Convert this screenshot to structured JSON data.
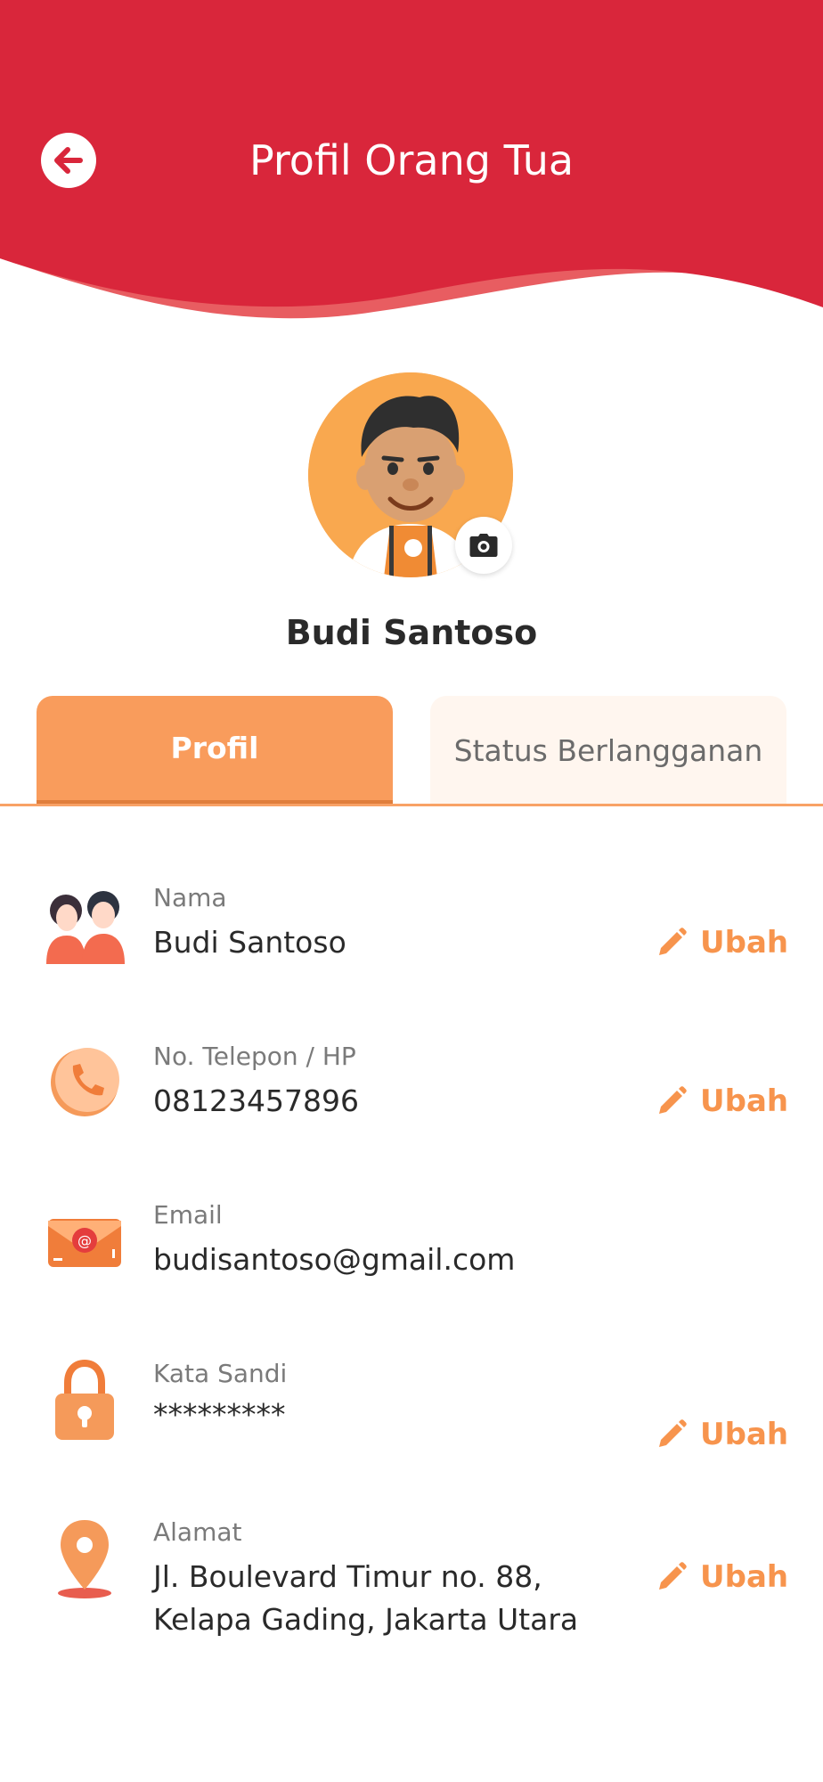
{
  "header": {
    "title": "Profil Orang Tua"
  },
  "profile": {
    "name": "Budi Santoso"
  },
  "tabs": [
    {
      "label": "Profil",
      "active": true
    },
    {
      "label": "Status Berlangganan",
      "active": false
    }
  ],
  "fields": [
    {
      "label": "Nama",
      "value": "Budi Santoso",
      "icon": "parents-icon",
      "edit_label": "Ubah"
    },
    {
      "label": "No. Telepon / HP",
      "value": "08123457896",
      "icon": "phone-icon",
      "edit_label": "Ubah"
    },
    {
      "label": "Email",
      "value": "budisantoso@gmail.com",
      "icon": "email-icon"
    },
    {
      "label": "Kata Sandi",
      "value": "*********",
      "icon": "lock-icon",
      "edit_label": "Ubah"
    },
    {
      "label": "Alamat",
      "value_line1": "Jl. Boulevard Timur no. 88,",
      "value_line2": "Kelapa Gading, Jakarta Utara",
      "icon": "location-pin-icon",
      "edit_label": "Ubah"
    }
  ],
  "colors": {
    "header_red": "#d9263b",
    "accent_orange": "#f7944d",
    "tab_active": "#f99c5c",
    "tab_inactive": "#fff6ef"
  }
}
